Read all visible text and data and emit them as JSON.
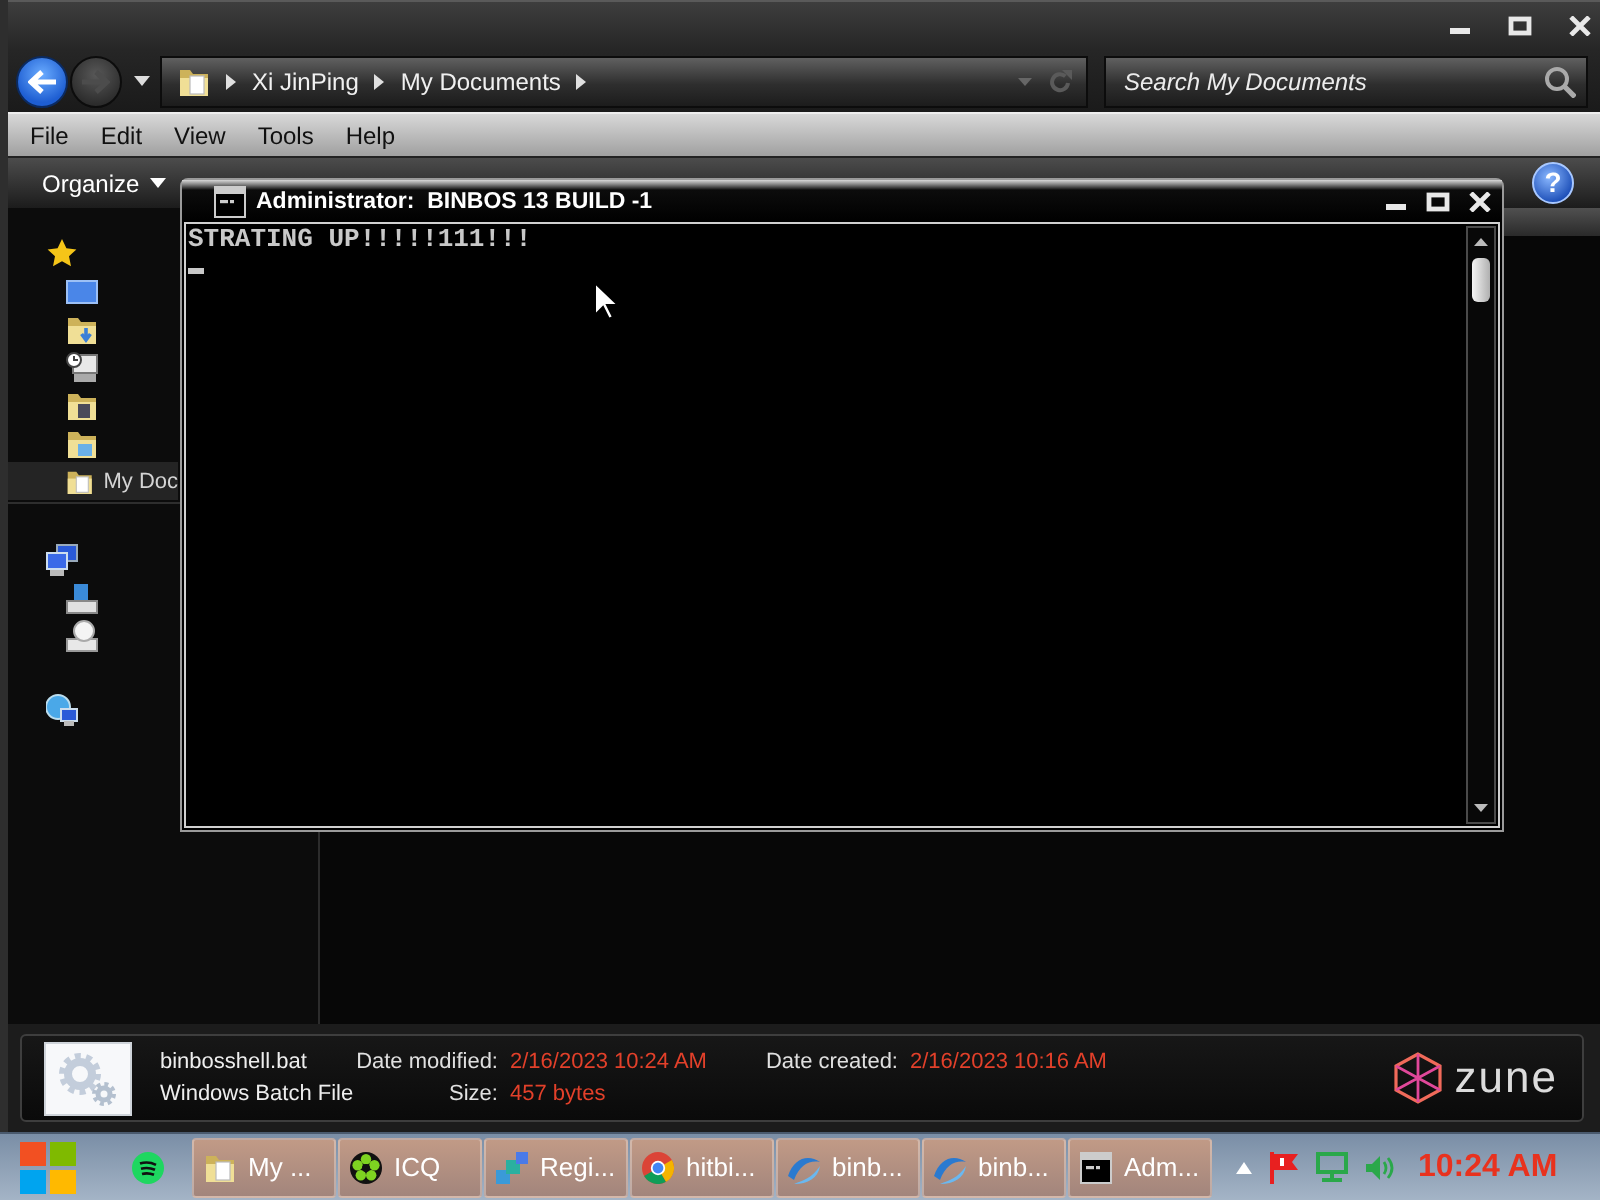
{
  "nav": {
    "back": {
      "disabled": false
    },
    "forward": {
      "disabled": true
    }
  },
  "address_bar": {
    "crumbs": [
      "Xi JinPing",
      "My Documents"
    ]
  },
  "search": {
    "placeholder": "Search My Documents"
  },
  "menu": [
    "File",
    "Edit",
    "View",
    "Tools",
    "Help"
  ],
  "command_bar": {
    "organize": "Organize",
    "help": "?"
  },
  "sidebar": {
    "items": [
      {
        "kind": "favorites",
        "selected": false,
        "children": [
          {
            "kind": "desktop",
            "selected": false
          },
          {
            "kind": "downloads",
            "selected": false
          },
          {
            "kind": "recent",
            "selected": false
          },
          {
            "kind": "videos",
            "selected": false
          },
          {
            "kind": "pictures",
            "selected": false
          },
          {
            "kind": "documents",
            "label": "My Doc",
            "selected": true
          }
        ]
      },
      {
        "kind": "computer",
        "selected": false,
        "children": [
          {
            "kind": "drive",
            "selected": false
          },
          {
            "kind": "disc",
            "selected": false
          }
        ]
      },
      {
        "kind": "network",
        "selected": false
      }
    ]
  },
  "console": {
    "title": "Administrator:  BINBOS 13 BUILD -1",
    "lines": [
      "STRATING UP!!!!!111!!!"
    ]
  },
  "details": {
    "file_name": "binbosshell.bat",
    "file_type": "Windows Batch File",
    "fields": [
      {
        "label": "Date modified:",
        "value": "2/16/2023 10:24 AM"
      },
      {
        "label": "Size:",
        "value": "457 bytes"
      },
      {
        "label": "Date created:",
        "value": "2/16/2023 10:16 AM"
      }
    ],
    "brand": "zune"
  },
  "taskbar": {
    "tasks": [
      {
        "kind": "folder",
        "label": "My ..."
      },
      {
        "kind": "flower",
        "label": "ICQ"
      },
      {
        "kind": "cubes",
        "label": "Regi..."
      },
      {
        "kind": "browser",
        "label": "hitbi..."
      },
      {
        "kind": "script",
        "label": "binb..."
      },
      {
        "kind": "script",
        "label": "binb..."
      },
      {
        "kind": "terminal",
        "label": "Adm..."
      }
    ],
    "clock": "10:24 AM"
  }
}
